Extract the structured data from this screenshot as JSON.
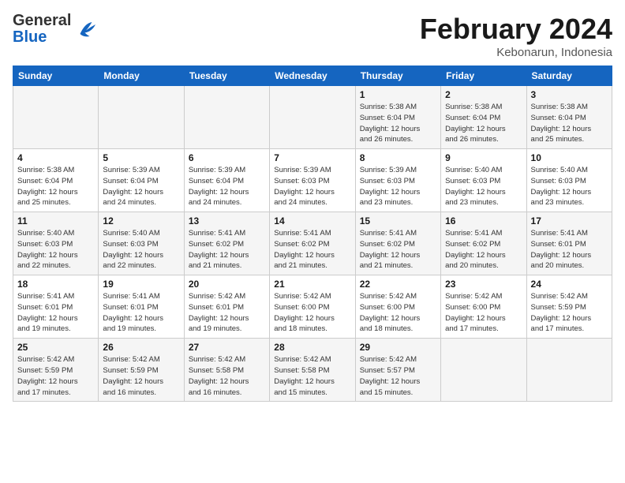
{
  "header": {
    "logo": {
      "line1": "General",
      "line2": "Blue"
    },
    "title": "February 2024",
    "subtitle": "Kebonarun, Indonesia"
  },
  "weekdays": [
    "Sunday",
    "Monday",
    "Tuesday",
    "Wednesday",
    "Thursday",
    "Friday",
    "Saturday"
  ],
  "weeks": [
    [
      {
        "day": "",
        "info": ""
      },
      {
        "day": "",
        "info": ""
      },
      {
        "day": "",
        "info": ""
      },
      {
        "day": "",
        "info": ""
      },
      {
        "day": "1",
        "info": "Sunrise: 5:38 AM\nSunset: 6:04 PM\nDaylight: 12 hours\nand 26 minutes."
      },
      {
        "day": "2",
        "info": "Sunrise: 5:38 AM\nSunset: 6:04 PM\nDaylight: 12 hours\nand 26 minutes."
      },
      {
        "day": "3",
        "info": "Sunrise: 5:38 AM\nSunset: 6:04 PM\nDaylight: 12 hours\nand 25 minutes."
      }
    ],
    [
      {
        "day": "4",
        "info": "Sunrise: 5:38 AM\nSunset: 6:04 PM\nDaylight: 12 hours\nand 25 minutes."
      },
      {
        "day": "5",
        "info": "Sunrise: 5:39 AM\nSunset: 6:04 PM\nDaylight: 12 hours\nand 24 minutes."
      },
      {
        "day": "6",
        "info": "Sunrise: 5:39 AM\nSunset: 6:04 PM\nDaylight: 12 hours\nand 24 minutes."
      },
      {
        "day": "7",
        "info": "Sunrise: 5:39 AM\nSunset: 6:03 PM\nDaylight: 12 hours\nand 24 minutes."
      },
      {
        "day": "8",
        "info": "Sunrise: 5:39 AM\nSunset: 6:03 PM\nDaylight: 12 hours\nand 23 minutes."
      },
      {
        "day": "9",
        "info": "Sunrise: 5:40 AM\nSunset: 6:03 PM\nDaylight: 12 hours\nand 23 minutes."
      },
      {
        "day": "10",
        "info": "Sunrise: 5:40 AM\nSunset: 6:03 PM\nDaylight: 12 hours\nand 23 minutes."
      }
    ],
    [
      {
        "day": "11",
        "info": "Sunrise: 5:40 AM\nSunset: 6:03 PM\nDaylight: 12 hours\nand 22 minutes."
      },
      {
        "day": "12",
        "info": "Sunrise: 5:40 AM\nSunset: 6:03 PM\nDaylight: 12 hours\nand 22 minutes."
      },
      {
        "day": "13",
        "info": "Sunrise: 5:41 AM\nSunset: 6:02 PM\nDaylight: 12 hours\nand 21 minutes."
      },
      {
        "day": "14",
        "info": "Sunrise: 5:41 AM\nSunset: 6:02 PM\nDaylight: 12 hours\nand 21 minutes."
      },
      {
        "day": "15",
        "info": "Sunrise: 5:41 AM\nSunset: 6:02 PM\nDaylight: 12 hours\nand 21 minutes."
      },
      {
        "day": "16",
        "info": "Sunrise: 5:41 AM\nSunset: 6:02 PM\nDaylight: 12 hours\nand 20 minutes."
      },
      {
        "day": "17",
        "info": "Sunrise: 5:41 AM\nSunset: 6:01 PM\nDaylight: 12 hours\nand 20 minutes."
      }
    ],
    [
      {
        "day": "18",
        "info": "Sunrise: 5:41 AM\nSunset: 6:01 PM\nDaylight: 12 hours\nand 19 minutes."
      },
      {
        "day": "19",
        "info": "Sunrise: 5:41 AM\nSunset: 6:01 PM\nDaylight: 12 hours\nand 19 minutes."
      },
      {
        "day": "20",
        "info": "Sunrise: 5:42 AM\nSunset: 6:01 PM\nDaylight: 12 hours\nand 19 minutes."
      },
      {
        "day": "21",
        "info": "Sunrise: 5:42 AM\nSunset: 6:00 PM\nDaylight: 12 hours\nand 18 minutes."
      },
      {
        "day": "22",
        "info": "Sunrise: 5:42 AM\nSunset: 6:00 PM\nDaylight: 12 hours\nand 18 minutes."
      },
      {
        "day": "23",
        "info": "Sunrise: 5:42 AM\nSunset: 6:00 PM\nDaylight: 12 hours\nand 17 minutes."
      },
      {
        "day": "24",
        "info": "Sunrise: 5:42 AM\nSunset: 5:59 PM\nDaylight: 12 hours\nand 17 minutes."
      }
    ],
    [
      {
        "day": "25",
        "info": "Sunrise: 5:42 AM\nSunset: 5:59 PM\nDaylight: 12 hours\nand 17 minutes."
      },
      {
        "day": "26",
        "info": "Sunrise: 5:42 AM\nSunset: 5:59 PM\nDaylight: 12 hours\nand 16 minutes."
      },
      {
        "day": "27",
        "info": "Sunrise: 5:42 AM\nSunset: 5:58 PM\nDaylight: 12 hours\nand 16 minutes."
      },
      {
        "day": "28",
        "info": "Sunrise: 5:42 AM\nSunset: 5:58 PM\nDaylight: 12 hours\nand 15 minutes."
      },
      {
        "day": "29",
        "info": "Sunrise: 5:42 AM\nSunset: 5:57 PM\nDaylight: 12 hours\nand 15 minutes."
      },
      {
        "day": "",
        "info": ""
      },
      {
        "day": "",
        "info": ""
      }
    ]
  ]
}
